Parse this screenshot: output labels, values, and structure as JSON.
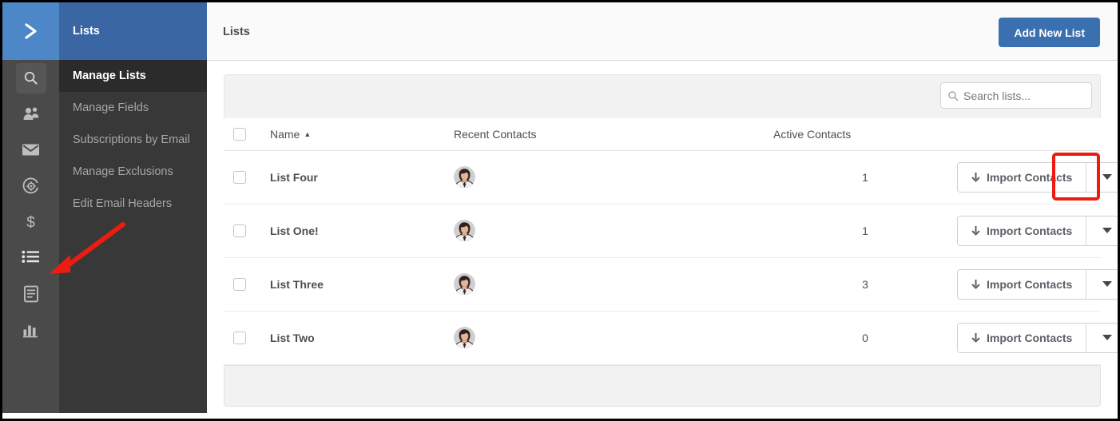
{
  "app": {
    "logo_icon": "chevron-right-logo"
  },
  "icon_rail": {
    "items": [
      {
        "name": "search",
        "icon": "search-icon"
      },
      {
        "name": "contacts",
        "icon": "people-icon"
      },
      {
        "name": "email",
        "icon": "envelope-icon"
      },
      {
        "name": "automations",
        "icon": "gear-circle-icon"
      },
      {
        "name": "deals",
        "icon": "dollar-icon"
      },
      {
        "name": "lists",
        "icon": "list-icon"
      },
      {
        "name": "forms",
        "icon": "document-icon"
      },
      {
        "name": "reports",
        "icon": "bar-chart-icon"
      }
    ]
  },
  "sidebar": {
    "title": "Lists",
    "items": [
      {
        "label": "Manage Lists",
        "active": true
      },
      {
        "label": "Manage Fields",
        "active": false
      },
      {
        "label": "Subscriptions by Email",
        "active": false
      },
      {
        "label": "Manage Exclusions",
        "active": false
      },
      {
        "label": "Edit Email Headers",
        "active": false
      }
    ]
  },
  "topbar": {
    "title": "Lists",
    "add_button": "Add New List"
  },
  "search": {
    "placeholder": "Search lists...",
    "value": "",
    "icon": "search-icon"
  },
  "table": {
    "columns": {
      "name": "Name",
      "recent_contacts": "Recent Contacts",
      "active_contacts": "Active Contacts"
    },
    "sort": {
      "column": "Name",
      "direction": "asc",
      "glyph": "▲"
    },
    "rows": [
      {
        "name": "List Four",
        "active_contacts": "1",
        "action_label": "Import Contacts",
        "highlighted": true
      },
      {
        "name": "List One!",
        "active_contacts": "1",
        "action_label": "Import Contacts",
        "highlighted": false
      },
      {
        "name": "List Three",
        "active_contacts": "3",
        "action_label": "Import Contacts",
        "highlighted": false
      },
      {
        "name": "List Two",
        "active_contacts": "0",
        "action_label": "Import Contacts",
        "highlighted": false
      }
    ]
  },
  "annotations": {
    "arrow_target": "list-icon",
    "highlight_target": "first-row-dropdown-caret",
    "color": "#ee1b11"
  },
  "colors": {
    "brand_blue": "#3a67a4",
    "logo_blue": "#4e87c7",
    "button_blue": "#3a6fb0",
    "sidebar_dark": "#383838",
    "rail_dark": "#4a4a4a",
    "active_item": "#2b2b2b",
    "annotation_red": "#ee1b11"
  }
}
